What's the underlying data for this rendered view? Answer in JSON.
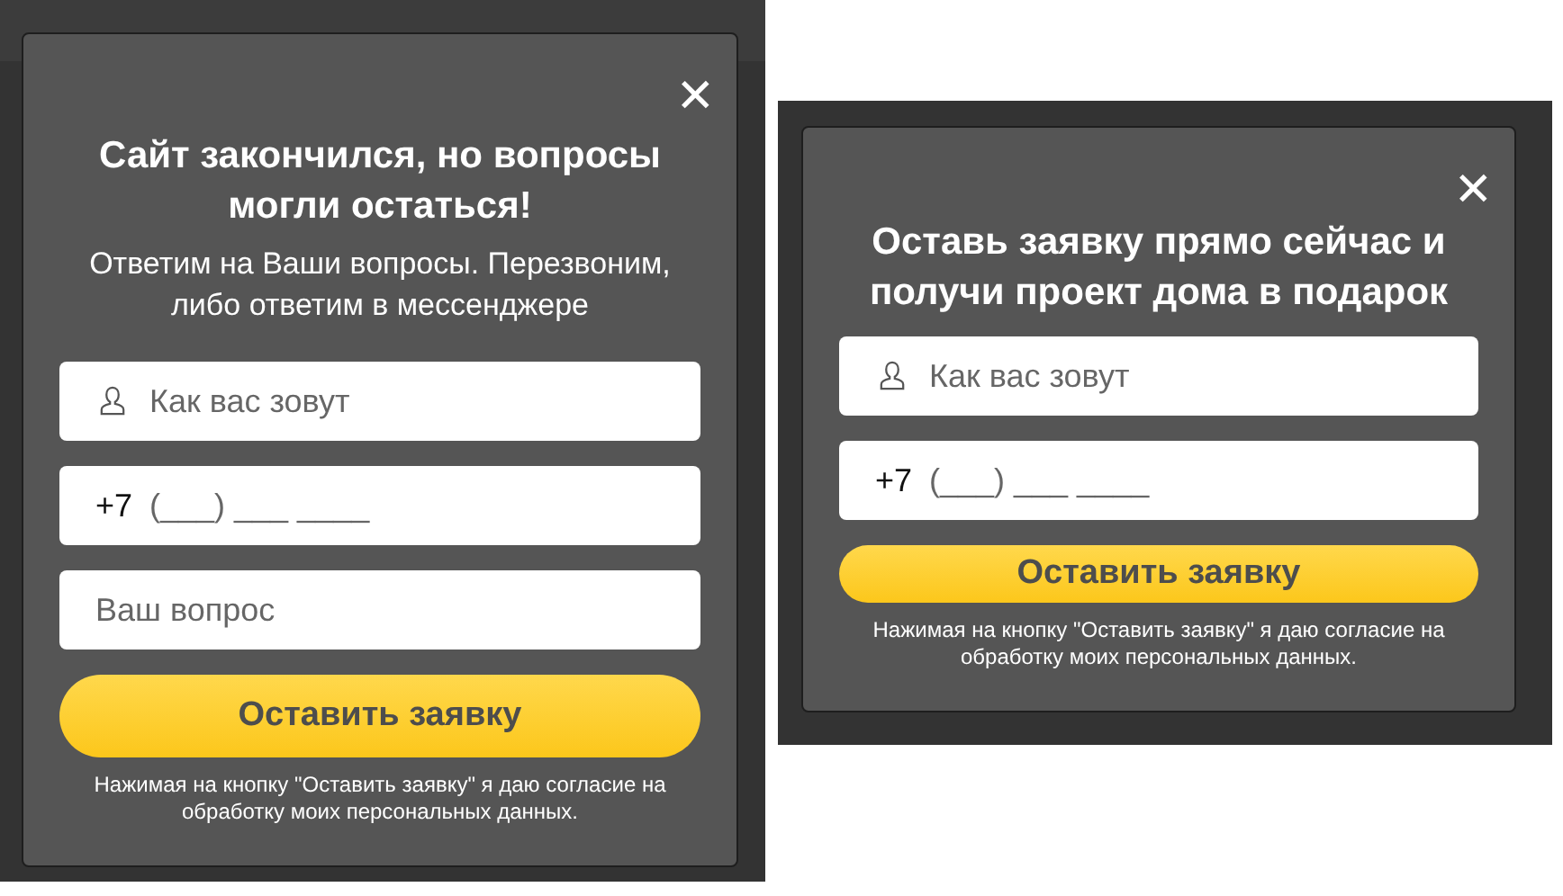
{
  "popups": [
    {
      "title": "Сайт закончился, но вопросы могли остаться!",
      "subtitle": "Ответим на Ваши вопросы. Перезвоним, либо ответим в мессенджере",
      "close": "✕",
      "fields": [
        {
          "kind": "name",
          "placeholder": "Как вас зовут"
        },
        {
          "kind": "phone",
          "prefix": "+7",
          "placeholder": "(___) ___ ____"
        },
        {
          "kind": "text",
          "placeholder": "Ваш вопрос"
        }
      ],
      "button": "Оставить заявку",
      "consent": "Нажимая на кнопку \"Оставить заявку\" я даю согласие на обработку моих персональных данных."
    },
    {
      "title": "Оставь заявку прямо сейчас и получи проект дома в подарок",
      "close": "✕",
      "fields": [
        {
          "kind": "name",
          "placeholder": "Как вас зовут"
        },
        {
          "kind": "phone",
          "prefix": "+7",
          "placeholder": "(___) ___ ____"
        }
      ],
      "button": "Оставить заявку",
      "consent": "Нажимая на кнопку \"Оставить заявку\" я даю согласие на обработку моих персональных данных."
    }
  ]
}
